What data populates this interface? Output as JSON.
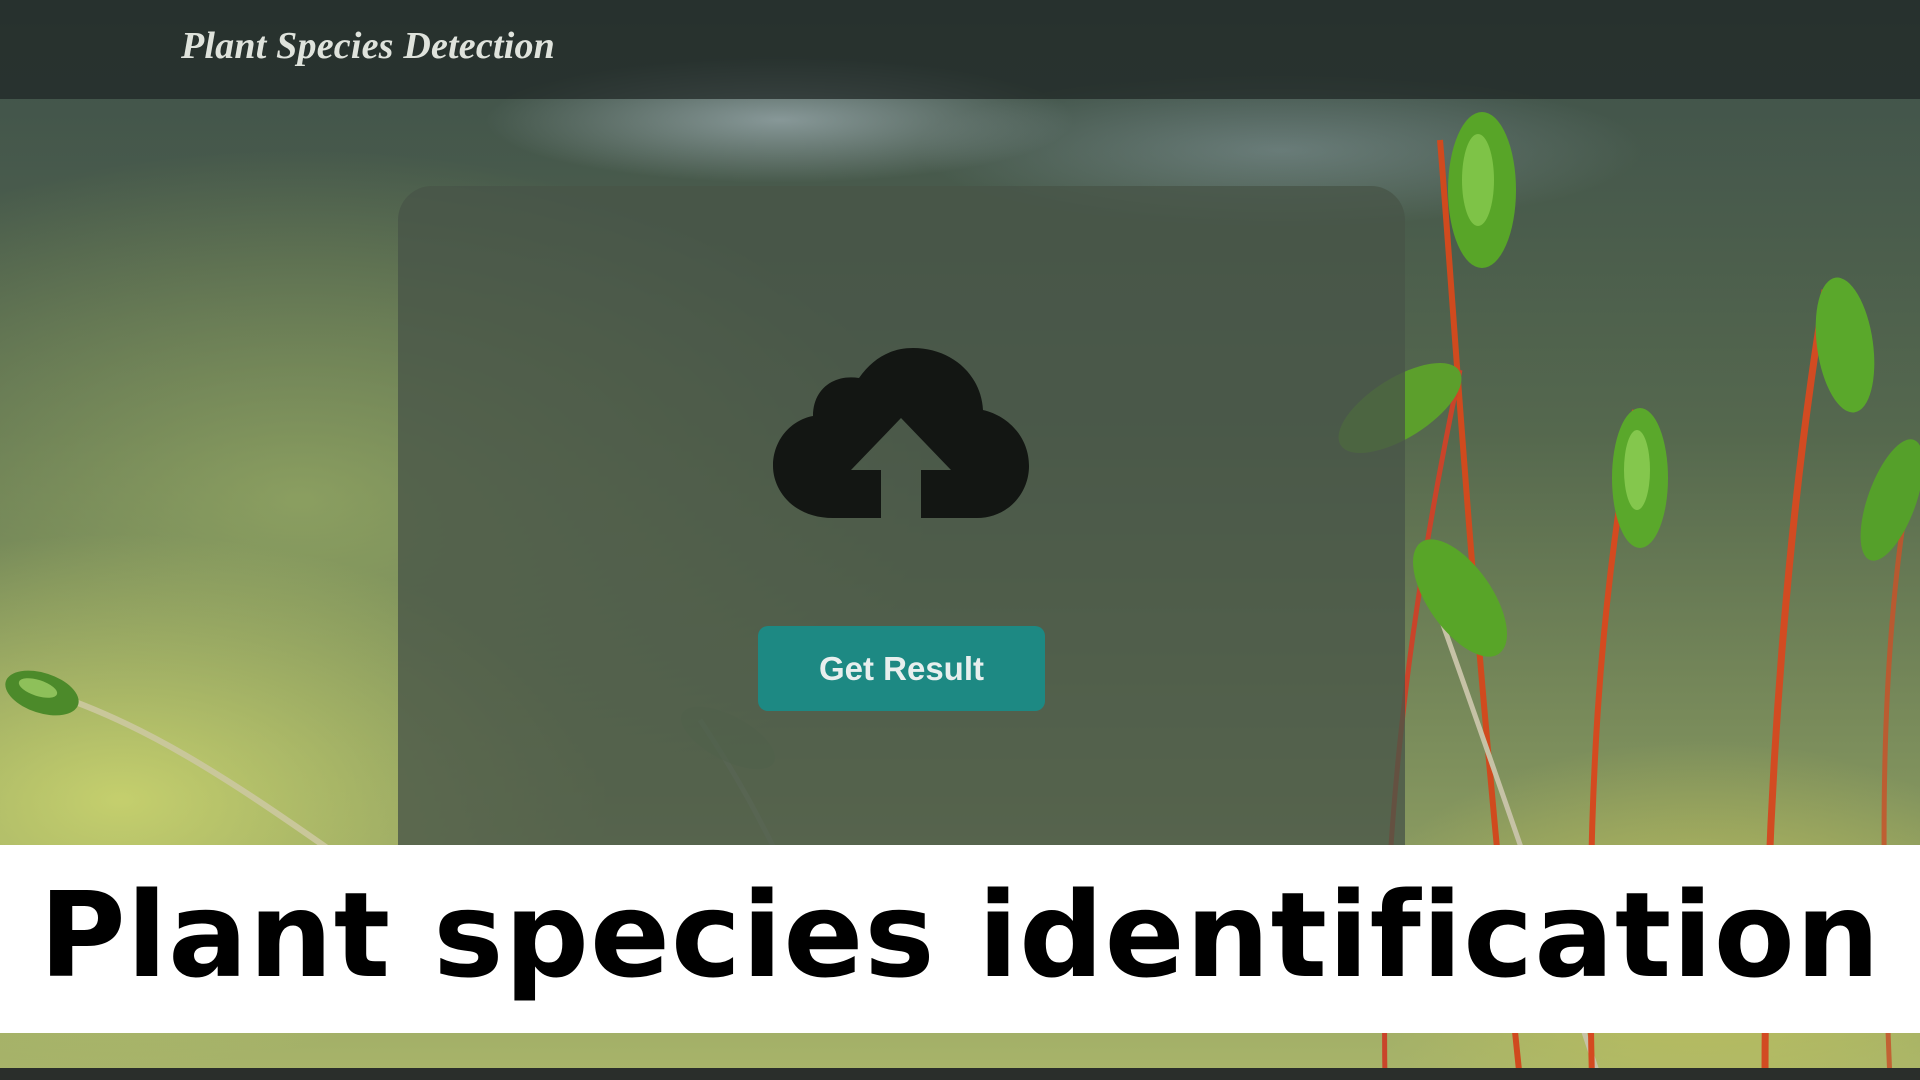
{
  "navbar": {
    "brand": "Plant Species Detection"
  },
  "upload": {
    "icon": "cloud-upload-icon",
    "button_label": "Get Result"
  },
  "caption": {
    "text": "Plant species identification"
  },
  "colors": {
    "button": "#1d8983",
    "navbar": "#2a3331",
    "caption_bg": "#ffffff",
    "caption_text": "#000000"
  }
}
